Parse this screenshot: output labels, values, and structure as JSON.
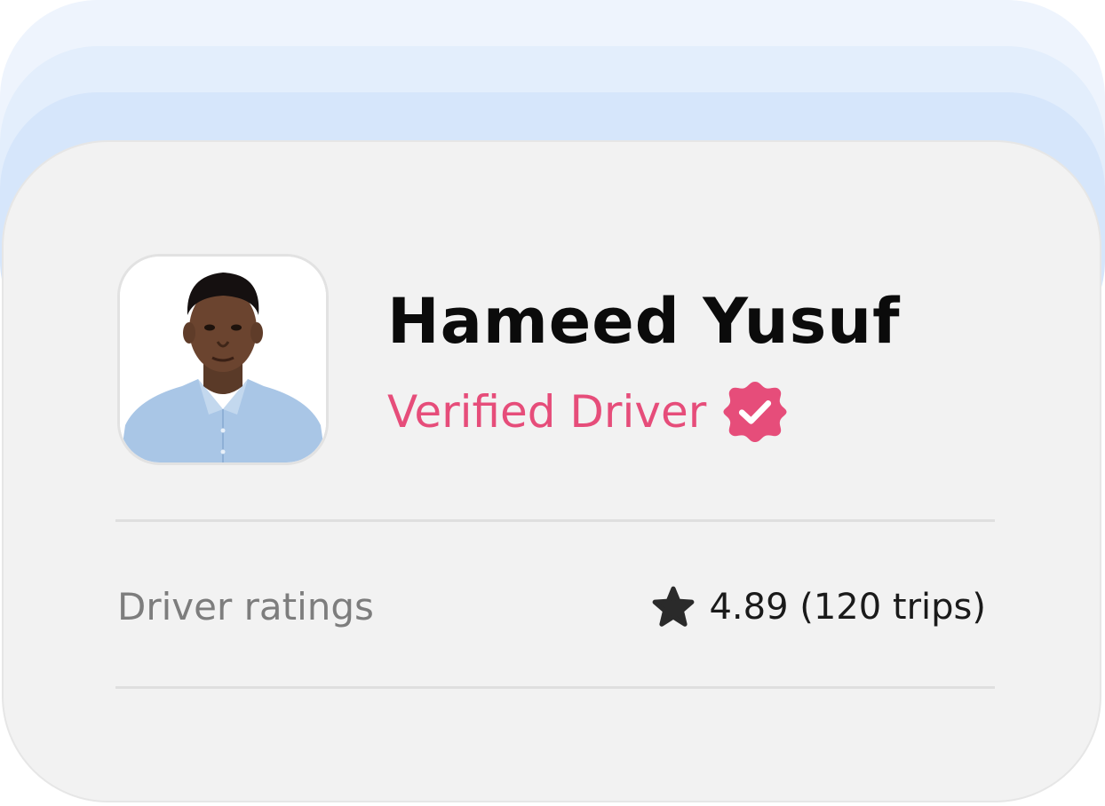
{
  "driver": {
    "name": "Hameed Yusuf",
    "status_label": "Verified Driver",
    "status_icon": "verified-badge-icon",
    "status_color": "#e64d7a",
    "avatar_alt": "driver photo"
  },
  "ratings": {
    "label": "Driver ratings",
    "icon": "star-icon",
    "value_text": "4.89 (120 trips)"
  },
  "theme": {
    "card_background": "#f2f2f2",
    "stack_colors": [
      "#eef4fd",
      "#e3eefc",
      "#d6e6fb"
    ],
    "name_color": "#0b0b0b",
    "muted_text": "#7d7d7d"
  }
}
